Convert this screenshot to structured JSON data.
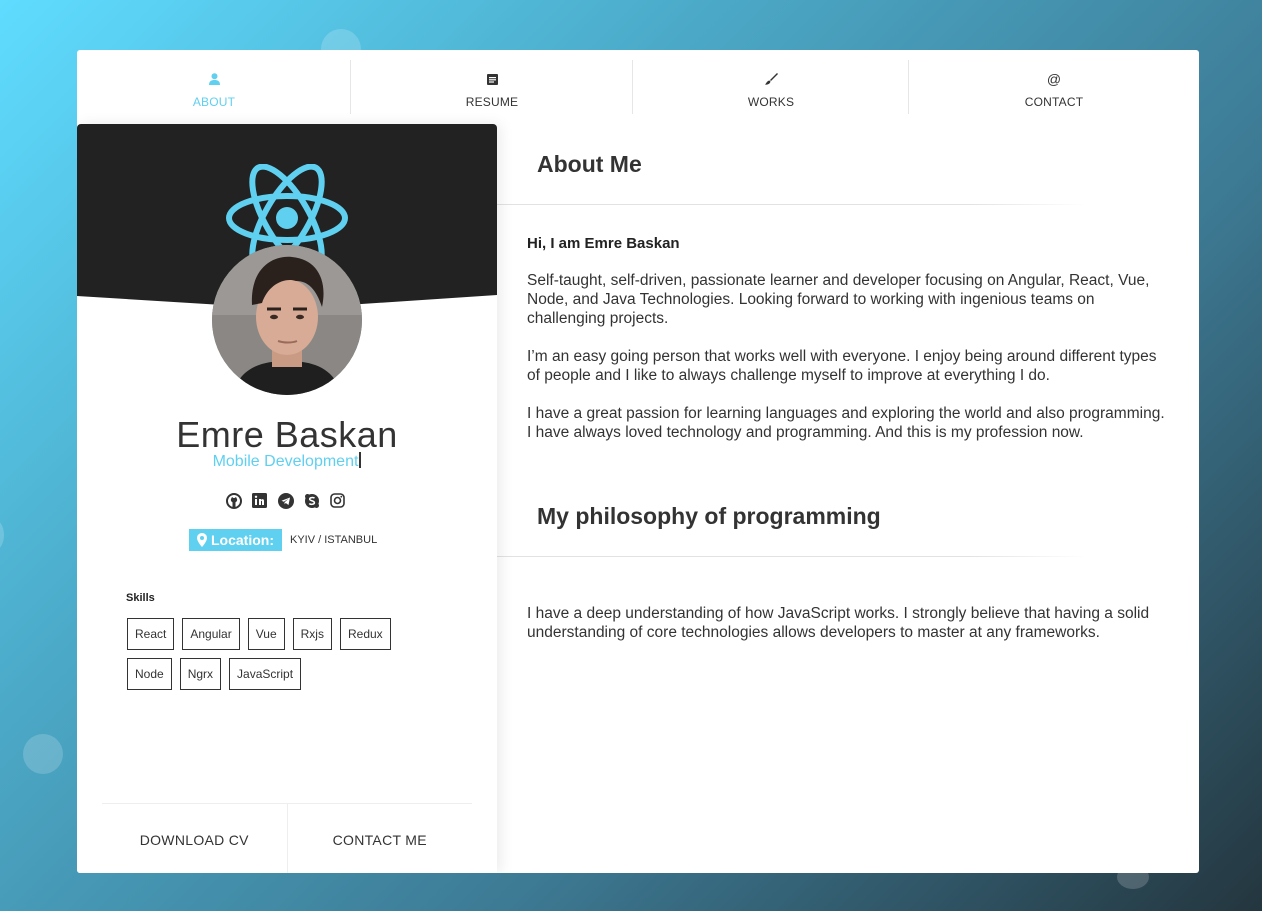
{
  "nav": {
    "items": [
      {
        "label": "ABOUT",
        "icon": "user-icon",
        "active": true
      },
      {
        "label": "RESUME",
        "icon": "document-icon",
        "active": false
      },
      {
        "label": "WORKS",
        "icon": "brush-icon",
        "active": false
      },
      {
        "label": "CONTACT",
        "icon": "at-icon",
        "active": false
      }
    ]
  },
  "profile": {
    "name": "Emre Baskan",
    "subtitle": "Mobile Development",
    "socials": [
      "github-icon",
      "linkedin-icon",
      "telegram-icon",
      "skype-icon",
      "instagram-icon"
    ],
    "location_label": "Location:",
    "location_value": "KYIV / ISTANBUL",
    "skills_title": "Skills",
    "skills": [
      "React",
      "Angular",
      "Vue",
      "Rxjs",
      "Redux",
      "Node",
      "Ngrx",
      "JavaScript"
    ],
    "download_cv": "DOWNLOAD CV",
    "contact_me": "CONTACT ME"
  },
  "about": {
    "title": "About Me",
    "greeting": "Hi, I am Emre Baskan",
    "paragraphs": [
      "Self-taught, self-driven, passionate learner and developer focusing on Angular, React, Vue, Node, and Java Technologies. Looking forward to working with ingenious teams on challenging projects.",
      "I’m an easy going person that works well with everyone. I enjoy being around different types of people and I like to always challenge myself to improve at everything I do.",
      "I have a great passion for learning languages and exploring the world and also programming. I have always loved technology and programming. And this is my profession now."
    ],
    "philosophy_title": "My philosophy of programming",
    "philosophy_text": "I have a deep understanding of how JavaScript works. I strongly believe that having a solid understanding of core technologies allows developers to master at any frameworks."
  },
  "colors": {
    "accent": "#5fd0f0",
    "card_header": "#222222",
    "text": "#333333"
  }
}
